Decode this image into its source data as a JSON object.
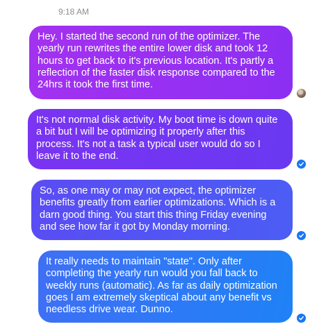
{
  "conversation": {
    "timestamp": "9:18 AM",
    "messages": [
      {
        "text": "Hey. I started the second run of the optimizer. The yearly run rewrites the entire lower disk and took 12 hours to get back to it's previous location. It's partly a reflection of the faster disk response compared to the 24hrs it took the first time.",
        "status": "seen-avatar"
      },
      {
        "text": "It's not normal disk activity. My boot time is down quite a bit but I will be optimizing it properly after this process. It's not a task a typical user would do so I leave it to the end.",
        "status": "delivered-check"
      },
      {
        "text": "So, as one may or may not expect, the optimizer benefits greatly from earlier optimizations. Which is a darn good thing. You start this thing Friday evening and see how far it got by Monday morning.",
        "status": "delivered-check"
      },
      {
        "text": "It really needs to maintain \"state\". Only after completing the yearly run would you fall back to weekly runs (automatic). As far as daily optimization goes I am extremely skeptical about any benefit vs needless drive wear. Dunno.",
        "status": "delivered-check"
      }
    ]
  },
  "colors": {
    "receipt": "#1877f2",
    "timestamp": "#8a8d91"
  }
}
